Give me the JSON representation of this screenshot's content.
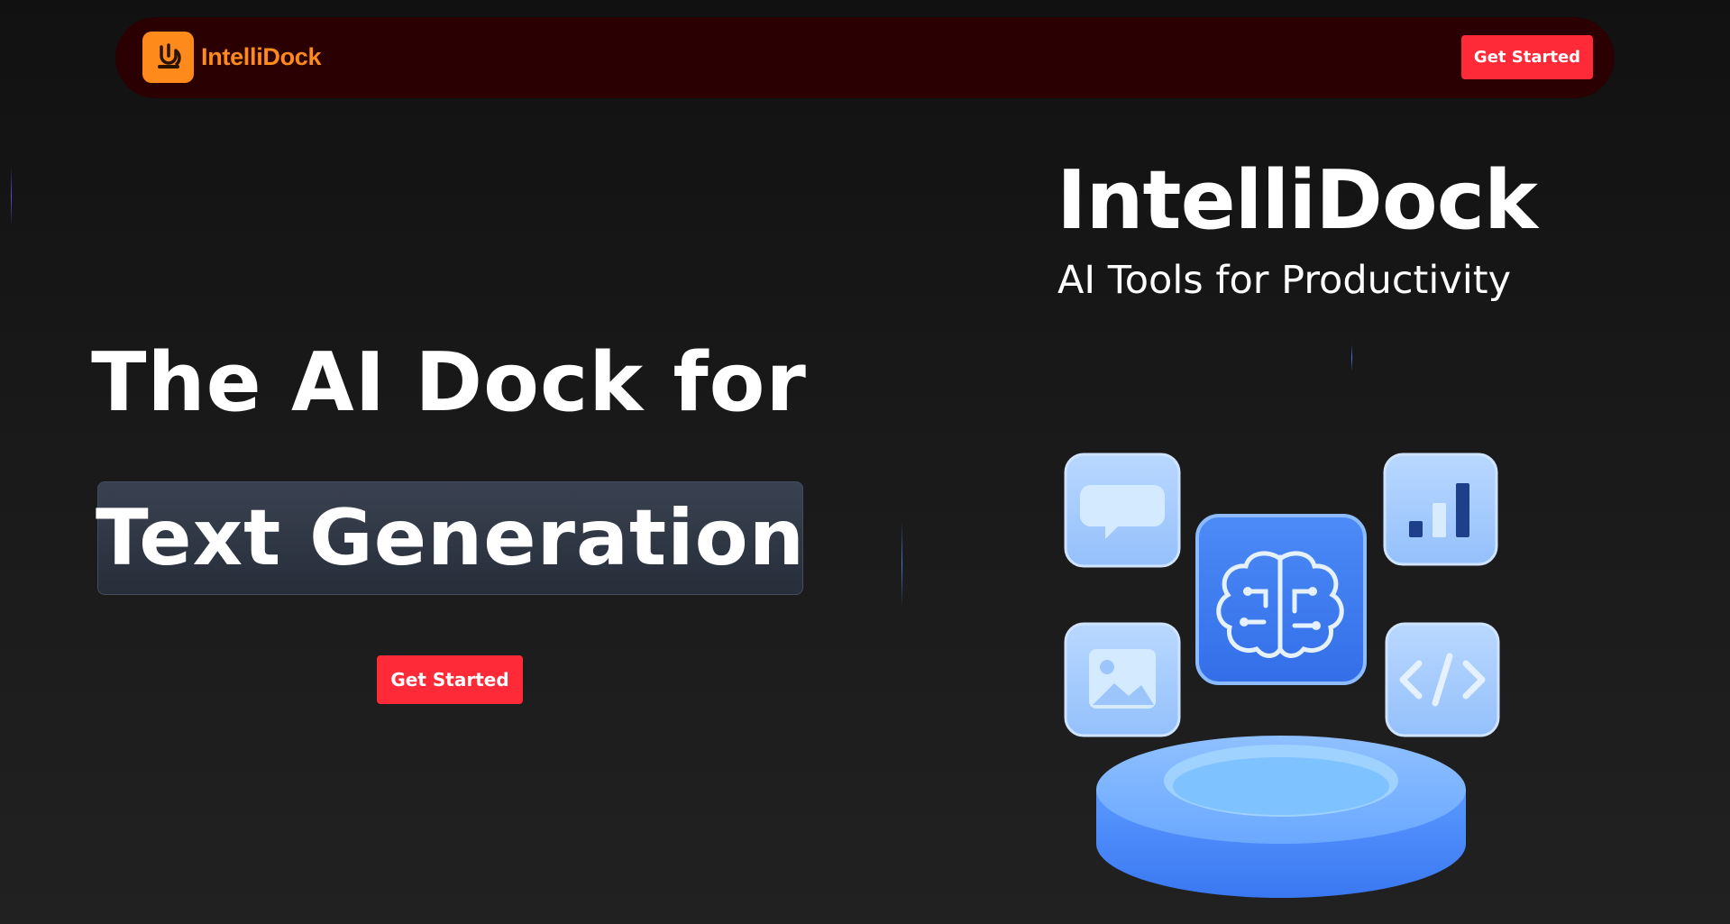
{
  "header": {
    "logo_text": "IntelliDock",
    "cta_label": "Get Started"
  },
  "hero": {
    "line1": "The AI Dock for",
    "line2": "Text Generation",
    "cta_label": "Get Started"
  },
  "brand_panel": {
    "title": "IntelliDock",
    "subtitle": "AI Tools for Productivity"
  },
  "illustration": {
    "icons": [
      "chat-bubble-icon",
      "bar-chart-icon",
      "brain-icon",
      "image-icon",
      "code-icon"
    ],
    "colors": {
      "tile_light": "#a9cdfd",
      "tile_core": "#3d7bf0",
      "platform": "#5b9cff"
    }
  },
  "colors": {
    "background": "#151515",
    "navbar": "#2a0002",
    "accent_orange": "#ff8a1c",
    "cta_red": "#ff2a38",
    "highlight_box": "#2f3644"
  }
}
